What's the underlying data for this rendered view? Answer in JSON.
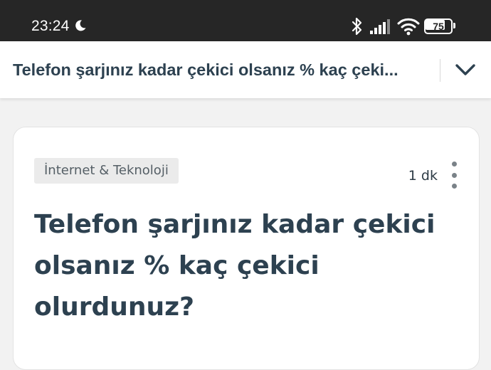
{
  "status_bar": {
    "time": "23:24",
    "battery_level": "75",
    "battery_fraction": 0.75
  },
  "app_bar": {
    "title": "Telefon şarjınız kadar çekici olsanız % kaç çeki..."
  },
  "card": {
    "category": "İnternet & Teknoloji",
    "read_time": "1 dk",
    "question": "Telefon şarjınız kadar çekici olsanız % kaç çekici olurdunuz?"
  },
  "icons": [
    "moon-icon",
    "bluetooth-icon",
    "signal-icon",
    "wifi-icon",
    "battery-icon",
    "chevron-down-icon",
    "more-vert-icon"
  ],
  "colors": {
    "status_bar_bg": "#262626",
    "title_text": "#2d4150",
    "page_bg": "#f2f2f2",
    "chip_bg": "#ebebeb"
  }
}
